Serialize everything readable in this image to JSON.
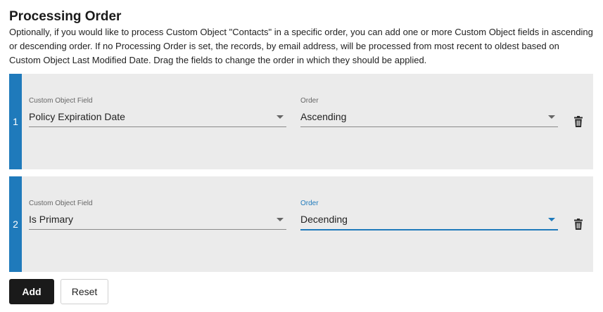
{
  "header": {
    "title": "Processing Order",
    "description": "Optionally, if you would like to process Custom Object \"Contacts\" in a specific order, you can add one or more Custom Object fields in ascending or descending order. If no Processing Order is set, the records, by email address, will be processed from most recent to oldest based on Custom Object Last Modified Date. Drag the fields to change the order in which they should be applied."
  },
  "rows": [
    {
      "number": "1",
      "field_label": "Custom Object Field",
      "field_value": "Policy Expiration Date",
      "order_label": "Order",
      "order_value": "Ascending"
    },
    {
      "number": "2",
      "field_label": "Custom Object Field",
      "field_value": "Is Primary",
      "order_label": "Order",
      "order_value": "Decending"
    }
  ],
  "buttons": {
    "add_label": "Add",
    "reset_label": "Reset"
  },
  "icons": {
    "delete": "trash-icon",
    "dropdown": "caret-down-icon"
  },
  "colors": {
    "accent": "#1f7abb",
    "row_bg": "#ebebeb",
    "primary_button": "#1a1a1a"
  }
}
